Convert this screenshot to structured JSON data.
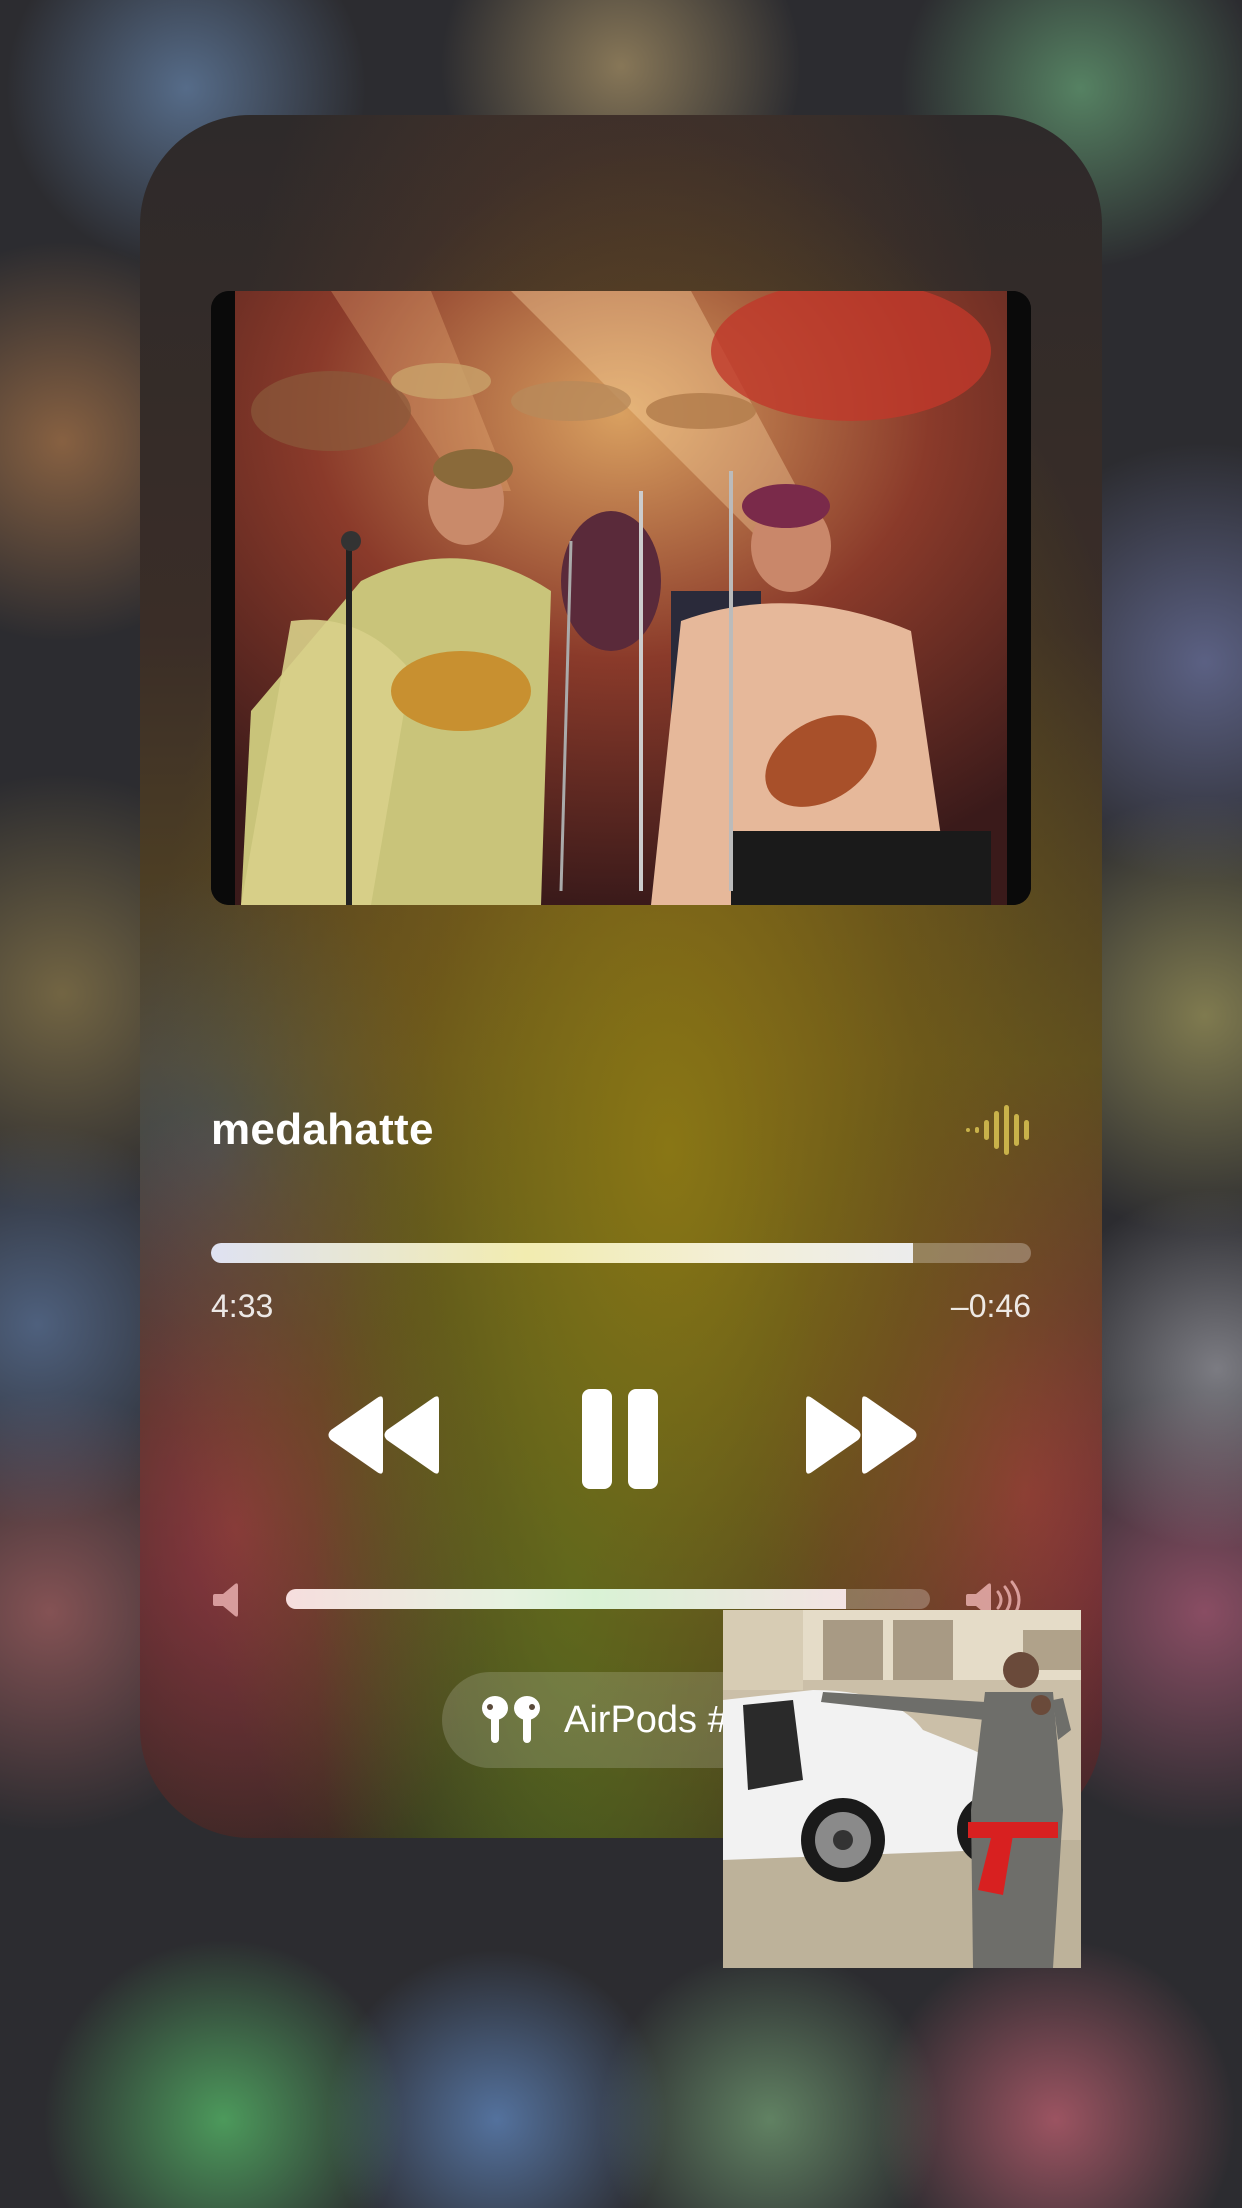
{
  "now_playing": {
    "title": "medahatte",
    "elapsed": "4:33",
    "remaining": "–0:46",
    "progress_fraction": 0.856,
    "accent_color": "#c9b24a"
  },
  "controls": {
    "rewind_icon": "rewind-icon",
    "pause_icon": "pause-icon",
    "forward_icon": "fast-forward-icon"
  },
  "volume": {
    "level_fraction": 0.87,
    "low_icon": "speaker-low-icon",
    "high_icon": "speaker-high-icon"
  },
  "output": {
    "label": "AirPods #",
    "icon": "airpods-icon"
  }
}
